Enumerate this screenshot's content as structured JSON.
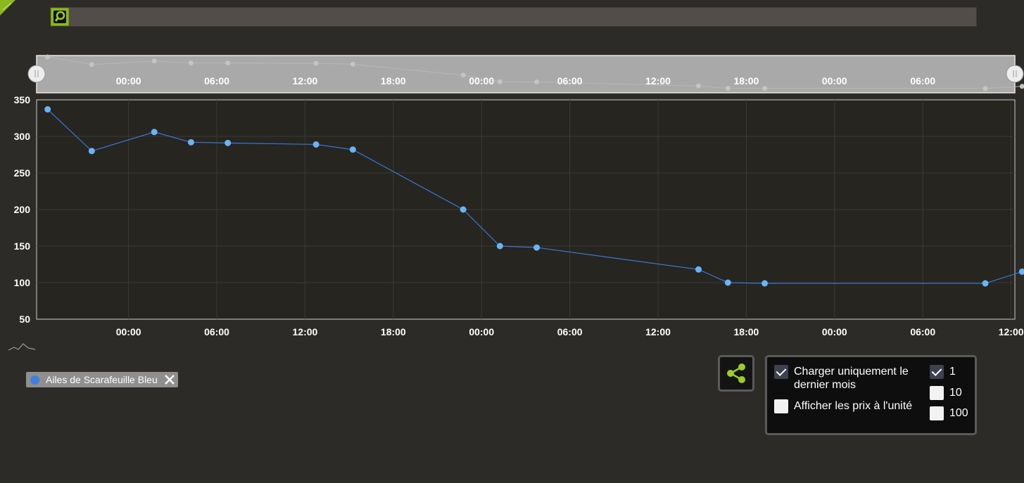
{
  "search": {
    "placeholder": ""
  },
  "chart_data": {
    "type": "line",
    "title": "",
    "xlabel": "",
    "ylabel": "",
    "ylim": [
      50,
      350
    ],
    "yticks": [
      50,
      100,
      150,
      200,
      250,
      300,
      350
    ],
    "xticks": [
      "00:00",
      "06:00",
      "12:00",
      "18:00",
      "00:00",
      "06:00",
      "12:00",
      "18:00",
      "00:00",
      "06:00",
      "12:00"
    ],
    "navigator_xticks": [
      "00:00",
      "06:00",
      "12:00",
      "18:00",
      "00:00",
      "06:00",
      "12:00",
      "18:00",
      "00:00",
      "06:00"
    ],
    "grid": true,
    "legend_placement": "bottom-left",
    "colors": {
      "line": "#3a78d8",
      "marker": "#6ab4f4",
      "navigator_marker": "#c4c4c4"
    },
    "series": [
      {
        "name": "Ailes de Scarafeuille Bleu",
        "x": [
          -5.5,
          -2.5,
          1.75,
          4.25,
          6.75,
          12.75,
          15.25,
          22.75,
          25.25,
          27.75,
          38.75,
          40.75,
          43.25,
          58.25,
          60.75
        ],
        "values": [
          337,
          280,
          306,
          292,
          291,
          289,
          282,
          200,
          150,
          148,
          118,
          100,
          99,
          99,
          115
        ]
      }
    ]
  },
  "legend": {
    "label": "Ailes de Scarafeuille Bleu"
  },
  "options": {
    "last_month_label": "Charger uniquement le dernier mois",
    "last_month_checked": true,
    "unit_price_label": "Afficher les prix à l'unité",
    "unit_price_checked": false,
    "quantities": [
      {
        "label": "1",
        "checked": true
      },
      {
        "label": "10",
        "checked": false
      },
      {
        "label": "100",
        "checked": false
      }
    ]
  }
}
